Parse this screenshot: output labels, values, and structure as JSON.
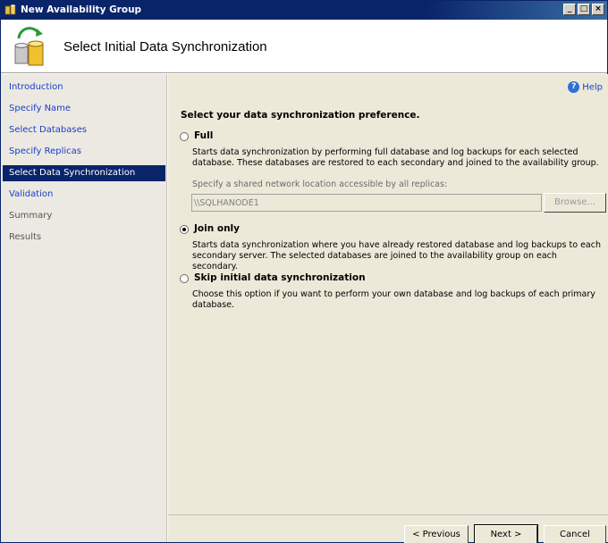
{
  "window": {
    "title": "New Availability Group"
  },
  "header": {
    "title": "Select Initial Data Synchronization"
  },
  "sidebar": {
    "items": [
      {
        "label": "Introduction"
      },
      {
        "label": "Specify Name"
      },
      {
        "label": "Select Databases"
      },
      {
        "label": "Specify Replicas"
      },
      {
        "label": "Select Data Synchronization"
      },
      {
        "label": "Validation"
      },
      {
        "label": "Summary"
      },
      {
        "label": "Results"
      }
    ]
  },
  "main": {
    "help": "Help",
    "heading": "Select your data synchronization preference.",
    "options": {
      "full": {
        "label": "Full",
        "desc": "Starts data synchronization by performing full database and log backups for each selected database. These databases are restored to each secondary and joined to the availability group.",
        "selected": false
      },
      "join": {
        "label": "Join only",
        "desc": "Starts data synchronization where you have already restored database and log backups to each secondary server. The selected databases are joined to the availability group on each secondary.",
        "selected": true
      },
      "skip": {
        "label": "Skip initial data synchronization",
        "desc": "Choose this option if you want to perform your own database and log backups of each primary database.",
        "selected": false
      }
    },
    "share_label": "Specify a shared network location accessible by all replicas:",
    "share_value": "\\\\SQLHANODE1",
    "browse_label": "Browse..."
  },
  "footer": {
    "previous": "< Previous",
    "next": "Next >",
    "cancel": "Cancel"
  },
  "colors": {
    "titlebar": "#0a246a",
    "selected_nav": "#0a246a",
    "link": "#1a3ec8"
  },
  "icons": {
    "window": "availability-group-icon",
    "header": "database-sync-icon",
    "help": "help-icon"
  }
}
